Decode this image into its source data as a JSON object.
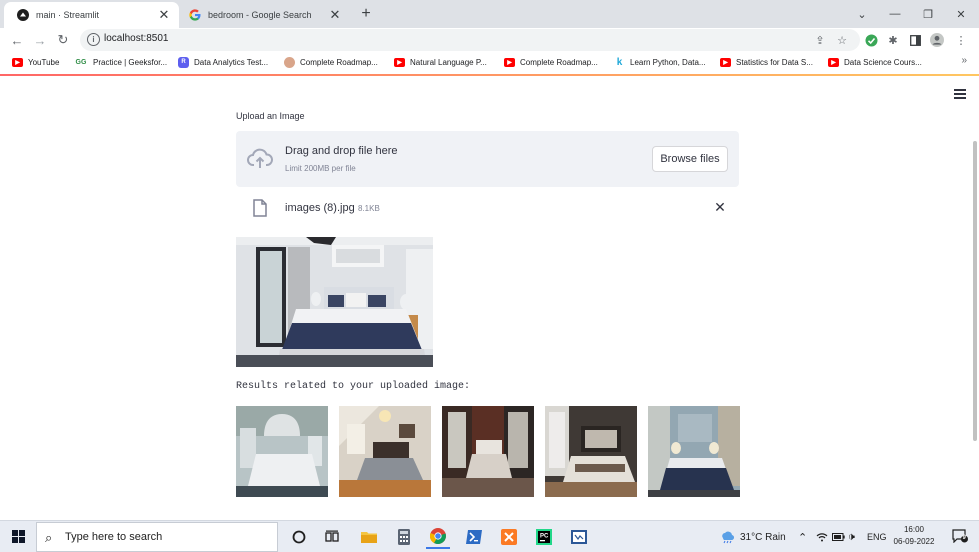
{
  "browser": {
    "tabs": [
      {
        "title": "main · Streamlit",
        "favicon": "streamlit-icon",
        "active": true
      },
      {
        "title": "bedroom - Google Search",
        "favicon": "google-icon",
        "active": false
      }
    ],
    "url": "localhost:8501",
    "bookmarks": [
      {
        "label": "YouTube",
        "icon": "youtube-icon"
      },
      {
        "label": "Practice | Geeksfor...",
        "icon": "geeksforgeeks-icon"
      },
      {
        "label": "Data Analytics Test...",
        "icon": "bookmark-icon"
      },
      {
        "label": "Complete Roadmap...",
        "icon": "avatar-icon"
      },
      {
        "label": "Natural Language P...",
        "icon": "youtube-icon"
      },
      {
        "label": "Complete Roadmap...",
        "icon": "youtube-icon"
      },
      {
        "label": "Learn Python, Data...",
        "icon": "k-icon"
      },
      {
        "label": "Statistics for Data S...",
        "icon": "youtube-icon"
      },
      {
        "label": "Data Science Cours...",
        "icon": "youtube-icon"
      }
    ]
  },
  "app": {
    "upload_label": "Upload an Image",
    "dropzone_main": "Drag and drop file here",
    "dropzone_sub": "Limit 200MB per file",
    "browse_label": "Browse files",
    "file_name": "images (8).jpg",
    "file_size": "8.1KB",
    "results_label": "Results related to your uploaded image:"
  },
  "taskbar": {
    "search_placeholder": "Type here to search",
    "weather": "31°C  Rain",
    "language": "ENG",
    "time": "16:00",
    "date": "06-09-2022",
    "notification_count": "9"
  },
  "colors": {
    "accent": "#ff4b4b",
    "dropzone_bg": "#f0f2f6",
    "text": "#31333f",
    "muted": "#808495"
  }
}
